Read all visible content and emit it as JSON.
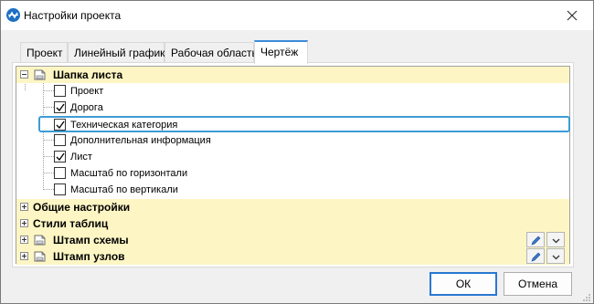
{
  "window": {
    "title": "Настройки проекта",
    "icon": "app-logo-icon",
    "close_icon": "close-icon"
  },
  "tabs": [
    {
      "label": "Проект",
      "active": false
    },
    {
      "label": "Линейный график",
      "active": false
    },
    {
      "label": "Рабочая область",
      "active": false
    },
    {
      "label": "Чертёж",
      "active": true
    }
  ],
  "tree": {
    "header_group": {
      "label": "Шапка листа",
      "expanded": true,
      "items": [
        {
          "label": "Проект",
          "checked": false
        },
        {
          "label": "Дорога",
          "checked": true
        },
        {
          "label": "Техническая категория",
          "checked": true,
          "selected": true
        },
        {
          "label": "Дополнительная информация",
          "checked": false
        },
        {
          "label": "Лист",
          "checked": true
        },
        {
          "label": "Масштаб по горизонтали",
          "checked": false
        },
        {
          "label": "Масштаб по вертикали",
          "checked": false
        }
      ]
    },
    "groups": [
      {
        "label": "Общие настройки",
        "expanded": false,
        "has_doc_icon": false,
        "has_buttons": false
      },
      {
        "label": "Стили таблиц",
        "expanded": false,
        "has_doc_icon": false,
        "has_buttons": false
      },
      {
        "label": "Штамп схемы",
        "expanded": false,
        "has_doc_icon": true,
        "has_buttons": true
      },
      {
        "label": "Штамп узлов",
        "expanded": false,
        "has_doc_icon": true,
        "has_buttons": true
      }
    ]
  },
  "buttons": {
    "ok": "ОК",
    "cancel": "Отмена"
  },
  "colors": {
    "group_bg": "#fdf6c4",
    "selection_border": "#3d9bd6",
    "accent": "#2a78d2"
  }
}
